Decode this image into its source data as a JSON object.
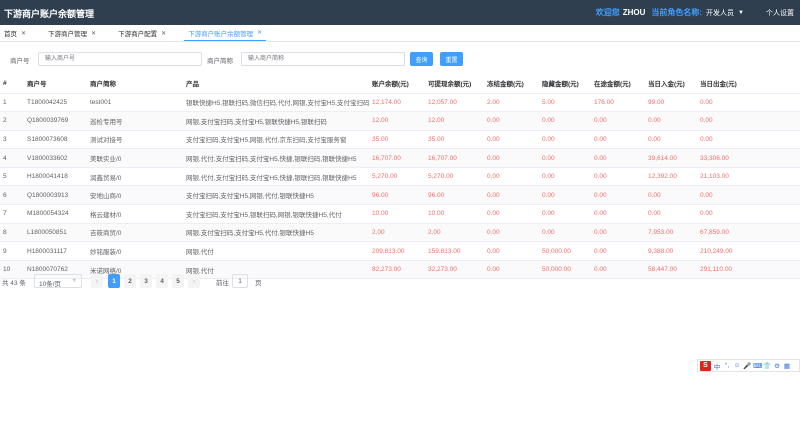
{
  "header": {
    "app_title": "下游商户账户余额管理",
    "welcome": "欢迎您",
    "username": "ZHOU",
    "role_label": "当前角色名称:",
    "role_value": "开发人员",
    "settings": "个人设置"
  },
  "tabs": [
    {
      "label": "首页",
      "active": false
    },
    {
      "label": "下游商户管理",
      "active": false
    },
    {
      "label": "下游商户配置",
      "active": false
    },
    {
      "label": "下游商户账户余额管理",
      "active": true
    }
  ],
  "filters": {
    "merchant_no_label": "商户号",
    "merchant_no_placeholder": "输入商户号",
    "merchant_name_label": "商户简称",
    "merchant_name_placeholder": "输入商户简称",
    "query_label": "查询",
    "reset_label": "重置"
  },
  "table": {
    "columns": [
      "#",
      "商户号",
      "商户简称",
      "产品",
      "账户余额(元)",
      "可提现余额(元)",
      "冻结金额(元)",
      "隐藏金额(元)",
      "在途金额(元)",
      "当日入金(元)",
      "当日出金(元)"
    ],
    "rows": [
      {
        "idx": "1",
        "merchant_no": "T1800042425",
        "name": "test001",
        "products": "银联快捷H5,银联扫码,微信扫码,代付,网银,支付宝H5,支付宝扫码",
        "balance": "12,174.00",
        "withdrawable": "12,057.00",
        "frozen": "2.00",
        "hidden": "5.00",
        "in_transit": "176.00",
        "day_in": "99.00",
        "day_out": "0.00"
      },
      {
        "idx": "2",
        "merchant_no": "Q1800039769",
        "name": "巡检专用号",
        "products": "网银,支付宝扫码,支付宝H5,银联快捷H5,银联扫码",
        "balance": "12.00",
        "withdrawable": "12.00",
        "frozen": "0.00",
        "hidden": "0.00",
        "in_transit": "0.00",
        "day_in": "0.00",
        "day_out": "0.00"
      },
      {
        "idx": "3",
        "merchant_no": "S1800073608",
        "name": "测试对接号",
        "products": "支付宝扫码,支付宝H5,网银,代付,京东扫码,支付宝服务窗",
        "balance": "35.00",
        "withdrawable": "35.00",
        "frozen": "0.00",
        "hidden": "0.00",
        "in_transit": "0.00",
        "day_in": "0.00",
        "day_out": "0.00"
      },
      {
        "idx": "4",
        "merchant_no": "V1800033602",
        "name": "美联实业/0",
        "products": "网银,代付,支付宝扫码,支付宝H5,快捷,银联扫码,银联快捷H5",
        "balance": "16,707.00",
        "withdrawable": "16,707.00",
        "frozen": "0.00",
        "hidden": "0.00",
        "in_transit": "0.00",
        "day_in": "39,614.00",
        "day_out": "33,306.00"
      },
      {
        "idx": "5",
        "merchant_no": "H1800041418",
        "name": "润鑫贸易/0",
        "products": "网银,代付,支付宝扫码,支付宝H5,快捷,银联扫码,银联快捷H5",
        "balance": "5,270.00",
        "withdrawable": "5,270.00",
        "frozen": "0.00",
        "hidden": "0.00",
        "in_transit": "0.00",
        "day_in": "12,392.00",
        "day_out": "21,103.00"
      },
      {
        "idx": "6",
        "merchant_no": "Q1800003913",
        "name": "安地山商/0",
        "products": "支付宝扫码,支付宝H5,网银,代付,银联快捷H5",
        "balance": "96.00",
        "withdrawable": "96.00",
        "frozen": "0.00",
        "hidden": "0.00",
        "in_transit": "0.00",
        "day_in": "0.00",
        "day_out": "0.00"
      },
      {
        "idx": "7",
        "merchant_no": "M1800054324",
        "name": "格云建材/0",
        "products": "支付宝扫码,支付宝H5,银联扫码,网银,银联快捷H5,代付",
        "balance": "10.00",
        "withdrawable": "10.00",
        "frozen": "0.00",
        "hidden": "0.00",
        "in_transit": "0.00",
        "day_in": "0.00",
        "day_out": "0.00"
      },
      {
        "idx": "8",
        "merchant_no": "L1800050851",
        "name": "吉筱商贸/0",
        "products": "网银,支付宝扫码,支付宝H5,代付,银联快捷H5",
        "balance": "2.00",
        "withdrawable": "2.00",
        "frozen": "0.00",
        "hidden": "0.00",
        "in_transit": "0.00",
        "day_in": "7,953.00",
        "day_out": "67,859.00"
      },
      {
        "idx": "9",
        "merchant_no": "H1800031117",
        "name": "妙铭服装/0",
        "products": "网银,代付",
        "balance": "209,813.00",
        "withdrawable": "159,813.00",
        "frozen": "0.00",
        "hidden": "50,000.00",
        "in_transit": "0.00",
        "day_in": "9,388.00",
        "day_out": "210,249.00"
      },
      {
        "idx": "10",
        "merchant_no": "N1800070762",
        "name": "米诺网络/0",
        "products": "网银,代付",
        "balance": "82,273.00",
        "withdrawable": "32,273.00",
        "frozen": "0.00",
        "hidden": "50,000.00",
        "in_transit": "0.00",
        "day_in": "58,447.00",
        "day_out": "291,110.00"
      }
    ]
  },
  "pagination": {
    "total": "共 43 条",
    "page_size": "10条/页",
    "prev": "‹",
    "pages": [
      "1",
      "2",
      "3",
      "4",
      "5"
    ],
    "current_page": "1",
    "next": "›",
    "goto_label": "前往",
    "goto_value": "1",
    "page_suffix": "页"
  },
  "ime_toolbar": {
    "logo": "S",
    "items": [
      "中",
      "°,",
      "☺",
      "🎤",
      "⌨",
      "👕",
      "⚙",
      "▦"
    ]
  },
  "colors": {
    "header_bg": "#2f3f50",
    "accent": "#409eff",
    "amount_red": "#f56c6c"
  }
}
